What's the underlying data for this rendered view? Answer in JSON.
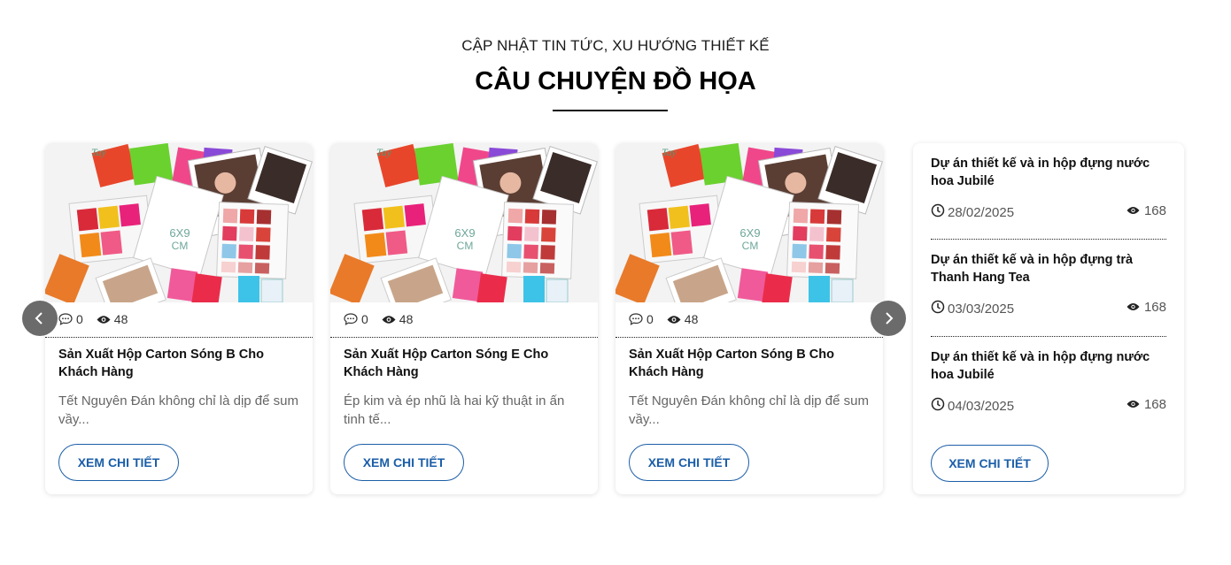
{
  "header": {
    "subtitle": "CẬP NHẬT TIN TỨC, XU HƯỚNG THIẾT KẾ",
    "title": "CÂU CHUYỆN ĐỒ HỌA"
  },
  "carousel": {
    "prev_icon": "chevron-left-icon",
    "next_icon": "chevron-right-icon",
    "cards": [
      {
        "image_text": "6X9 CM",
        "comments": "0",
        "views": "48",
        "title": "Sản Xuất Hộp Carton Sóng B Cho Khách Hàng",
        "excerpt": "Tết Nguyên Đán không chỉ là dịp để sum vầy...",
        "button": "XEM CHI TIẾT"
      },
      {
        "image_text": "6X9 CM",
        "comments": "0",
        "views": "48",
        "title": "Sản Xuất Hộp Carton Sóng E Cho Khách Hàng",
        "excerpt": "Ép kim và ép nhũ là hai kỹ thuật in ấn tinh tế...",
        "button": "XEM CHI TIẾT"
      },
      {
        "image_text": "6X9 CM",
        "comments": "0",
        "views": "48",
        "title": "Sản Xuất Hộp Carton Sóng B Cho Khách Hàng",
        "excerpt": "Tết Nguyên Đán không chỉ là dịp để sum vầy...",
        "button": "XEM CHI TIẾT"
      }
    ]
  },
  "sidebar": {
    "items": [
      {
        "title": "Dự án thiết kế và in hộp đựng nước hoa Jubilé",
        "date": "28/02/2025",
        "views": "168"
      },
      {
        "title": "Dự án thiết kế và in hộp đựng trà Thanh Hang Tea",
        "date": "03/03/2025",
        "views": "168"
      },
      {
        "title": "Dự án thiết kế và in hộp đựng nước hoa Jubilé",
        "date": "04/03/2025",
        "views": "168"
      }
    ],
    "button": "XEM CHI TIẾT"
  },
  "colors": {
    "accent": "#1b5ea8",
    "arrow_bg": "#6b6b6b",
    "muted_text": "#666666"
  }
}
